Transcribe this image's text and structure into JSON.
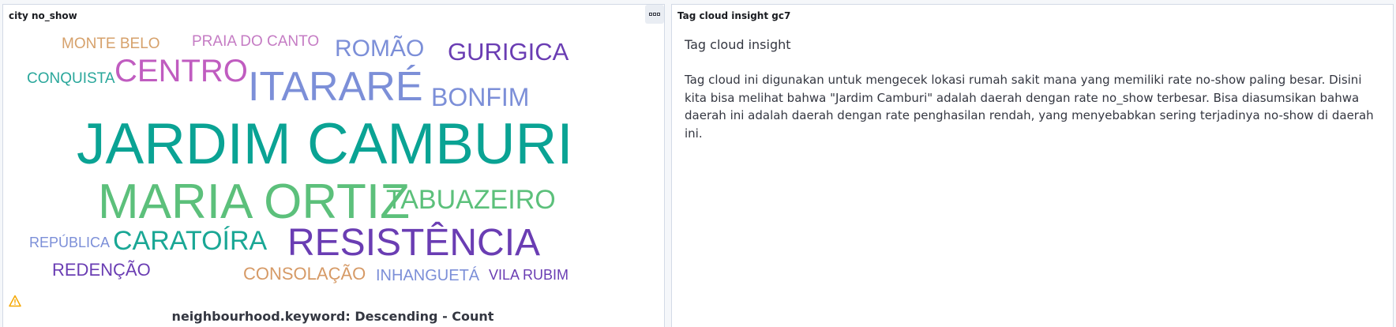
{
  "left_panel": {
    "title": "city no_show",
    "caption": "neighbourhood.keyword: Descending - Count",
    "menu_icon": "options-icon",
    "warning_icon": "warning-icon"
  },
  "right_panel": {
    "title": "Tag cloud insight gc7",
    "heading": "Tag cloud insight",
    "body": "Tag cloud ini digunakan untuk mengecek lokasi rumah sakit mana yang memiliki rate no-show paling besar. Disini kita bisa melihat bahwa \"Jardim Camburi\" adalah daerah dengan rate no_show terbesar. Bisa diasumsikan bahwa daerah ini adalah daerah dengan rate penghasilan rendah, yang menyebabkan sering terjadinya no-show di daerah ini."
  },
  "tag_cloud": {
    "words": [
      {
        "text": "MONTE BELO",
        "color": "#d6a16b"
      },
      {
        "text": "PRAIA DO CANTO",
        "color": "#c57cc4"
      },
      {
        "text": "ROMÃO",
        "color": "#7c8fd8"
      },
      {
        "text": "GURIGICA",
        "color": "#6a3db3"
      },
      {
        "text": "CONQUISTA",
        "color": "#2aa79b"
      },
      {
        "text": "CENTRO",
        "color": "#c05cc0"
      },
      {
        "text": "ITARARÉ",
        "color": "#7c8fd8"
      },
      {
        "text": "BONFIM",
        "color": "#7c8fd8"
      },
      {
        "text": "JARDIM CAMBURI",
        "color": "#0aa394"
      },
      {
        "text": "MARIA ORTIZ",
        "color": "#5cc07b"
      },
      {
        "text": "TABUAZEIRO",
        "color": "#5cc07b"
      },
      {
        "text": "REPÚBLICA",
        "color": "#7c8fd8"
      },
      {
        "text": "CARATOÍRA",
        "color": "#1aa795"
      },
      {
        "text": "RESISTÊNCIA",
        "color": "#6a3db3"
      },
      {
        "text": "REDENÇÃO",
        "color": "#6a3db3"
      },
      {
        "text": "CONSOLAÇÃO",
        "color": "#d69a66"
      },
      {
        "text": "INHANGUETÁ",
        "color": "#7c8fd8"
      },
      {
        "text": "VILA RUBIM",
        "color": "#6a3db3"
      }
    ]
  }
}
